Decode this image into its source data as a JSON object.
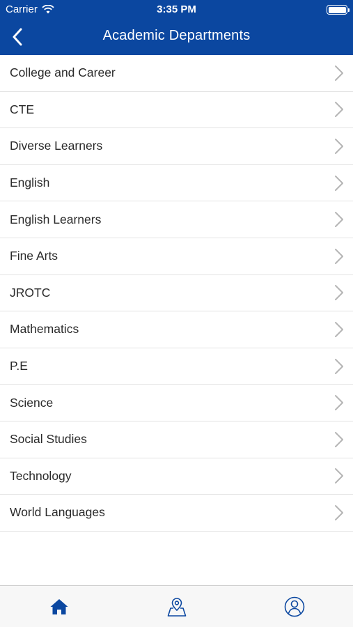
{
  "status_bar": {
    "carrier": "Carrier",
    "time": "3:35 PM",
    "wifi_icon": "wifi-icon",
    "battery_icon": "battery-icon"
  },
  "nav": {
    "title": "Academic Departments",
    "back_icon": "chevron-left-icon"
  },
  "departments": [
    {
      "label": "College and Career"
    },
    {
      "label": "CTE"
    },
    {
      "label": "Diverse Learners"
    },
    {
      "label": "English"
    },
    {
      "label": "English Learners"
    },
    {
      "label": "Fine Arts"
    },
    {
      "label": "JROTC"
    },
    {
      "label": "Mathematics"
    },
    {
      "label": "P.E"
    },
    {
      "label": "Science"
    },
    {
      "label": "Social Studies"
    },
    {
      "label": "Technology"
    },
    {
      "label": "World Languages"
    }
  ],
  "tab_bar": {
    "tabs": [
      {
        "icon": "home-icon"
      },
      {
        "icon": "map-pin-icon"
      },
      {
        "icon": "user-icon"
      }
    ]
  },
  "colors": {
    "brand_blue": "#0b47a0",
    "chevron_gray": "#b5b5b5",
    "tab_icon_blue": "#0b47a0"
  }
}
